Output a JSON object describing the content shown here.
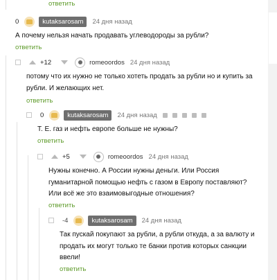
{
  "top": {
    "reply_label": "ответить"
  },
  "comments": [
    {
      "score": "0",
      "user": "kutaksarosam",
      "time": "24 дня назад",
      "text": "А почему нельзя начать продавать углеводороды за рубли?",
      "reply_label": "ответить"
    },
    {
      "score": "+12",
      "user": "romeoordos",
      "time": "24 дня назад",
      "text_lines": [
        "потому что их нужно не только хотеть продать за рубли но и купить за",
        "рубли. И желающих нет."
      ],
      "reply_label": "ответить"
    },
    {
      "score": "0",
      "user": "kutaksarosam",
      "time": "24 дня назад",
      "text": "Т. Е. газ и нефть европе больше не нужны?",
      "reply_label": "ответить"
    },
    {
      "score": "+5",
      "user": "romeoordos",
      "time": "24 дня назад",
      "text_lines": [
        "Нужны конечно. А России нужны деньги. Или Россия",
        "гуманитарной помощью нефть с газом в Европу поставляют?",
        "Или всё же это взаимовыгодные отношения?"
      ],
      "reply_label": "ответить"
    },
    {
      "score": "-4",
      "user": "kutaksarosam",
      "time": "24 дня назад",
      "text_lines": [
        "Так пускай покупают за рубли, а рубли откуда, а за валюту и",
        "продать их могут только те банки против которых санкции",
        "ввели!"
      ],
      "reply_label": "ответить"
    }
  ]
}
